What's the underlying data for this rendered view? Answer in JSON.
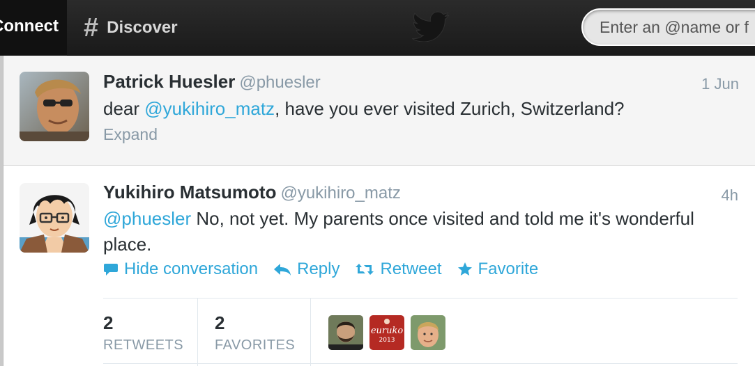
{
  "topbar": {
    "connect_label": "Connect",
    "discover_label": "Discover",
    "search_placeholder": "Enter an @name or f"
  },
  "tweets": [
    {
      "fullname": "Patrick Huesler",
      "handle": "@phuesler",
      "time": "1 Jun",
      "text_before": "dear ",
      "mention": "@yukihiro_matz",
      "text_after": ", have you ever visited Zurich, Switzerland?",
      "expand_label": "Expand"
    },
    {
      "fullname": "Yukihiro Matsumoto",
      "handle": "@yukihiro_matz",
      "time": "4h",
      "mention": "@phuesler",
      "text_after": " No, not yet. My parents once visited and told me it's wonderful place.",
      "actions": {
        "hide": "Hide conversation",
        "reply": "Reply",
        "retweet": "Retweet",
        "favorite": "Favorite"
      },
      "stats": {
        "retweets_count": "2",
        "retweets_label": "RETWEETS",
        "favorites_count": "2",
        "favorites_label": "FAVORITES"
      }
    }
  ],
  "colors": {
    "link": "#2fa7d9",
    "topbar": "#1f1f1f",
    "muted": "#8899a6"
  },
  "icons": [
    "hash-icon",
    "twitter-bird-icon",
    "speech-bubble-icon",
    "reply-arrow-icon",
    "retweet-icon",
    "star-icon"
  ]
}
